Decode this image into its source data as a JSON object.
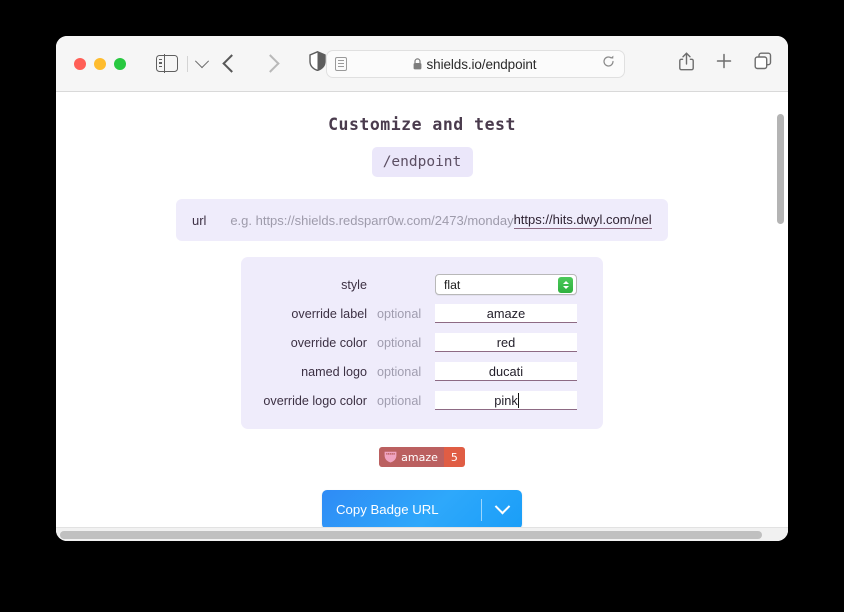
{
  "browser": {
    "traffic_lights": [
      "close",
      "minimize",
      "zoom"
    ],
    "sidebar_toggle": "sidebar-toggle",
    "tab_overview_chevron": "chevron-down",
    "back": "back-arrow",
    "forward": "forward-arrow",
    "privacy_shield": "shield",
    "address": {
      "reader_icon": "reader-view",
      "lock_icon": "lock",
      "url": "shields.io/endpoint",
      "reload_icon": "reload"
    },
    "share_icon": "share",
    "new_tab_icon": "plus",
    "tabs_icon": "tab-overview"
  },
  "page": {
    "title": "Customize and test",
    "endpoint_chip": "/endpoint",
    "url_row": {
      "key": "url",
      "placeholder": "e.g. https://shields.redsparr0w.com/2473/monday",
      "value": "https://hits.dwyl.com/nelso"
    },
    "form": {
      "rows": [
        {
          "label": "style",
          "optional": "",
          "type": "select",
          "value": "flat"
        },
        {
          "label": "override label",
          "optional": "optional",
          "type": "text",
          "value": "amaze"
        },
        {
          "label": "override color",
          "optional": "optional",
          "type": "text",
          "value": "red"
        },
        {
          "label": "named logo",
          "optional": "optional",
          "type": "text",
          "value": "ducati"
        },
        {
          "label": "override logo color",
          "optional": "optional",
          "type": "text",
          "value": "pink",
          "focused": true
        }
      ]
    },
    "badge": {
      "logo": "ducati-shield-icon",
      "logo_color": "#f0a3c0",
      "label": "amaze",
      "label_bg": "#bb6060",
      "message": "5",
      "message_bg": "#e05d44"
    },
    "copy_button": {
      "label": "Copy Badge URL",
      "dropdown_icon": "chevron-down",
      "accent": "#2ea8fb"
    }
  },
  "scrollbars": {
    "vertical": "vertical-scrollbar",
    "horizontal": "horizontal-scrollbar"
  }
}
